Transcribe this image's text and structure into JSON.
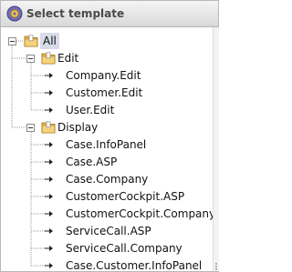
{
  "window": {
    "title": "Select template",
    "title_icon": "template-gear-icon"
  },
  "tree": {
    "root": {
      "label": "All",
      "expanded": true,
      "icon": "folder-open-icon"
    },
    "groups": [
      {
        "label": "Edit",
        "expanded": true,
        "icon": "folder-open-icon",
        "items": [
          "Company.Edit",
          "Customer.Edit",
          "User.Edit"
        ]
      },
      {
        "label": "Display",
        "expanded": true,
        "icon": "folder-open-icon",
        "items": [
          "Case.InfoPanel",
          "Case.ASP",
          "Case.Company",
          "CustomerCockpit.ASP",
          "CustomerCockpit.Company",
          "ServiceCall.ASP",
          "ServiceCall.Company",
          "Case.Customer.InfoPanel"
        ]
      }
    ]
  },
  "colors": {
    "selection": "#d7dde8",
    "folder": "#e8b84a",
    "tree_lines": "#9a9a9a"
  }
}
